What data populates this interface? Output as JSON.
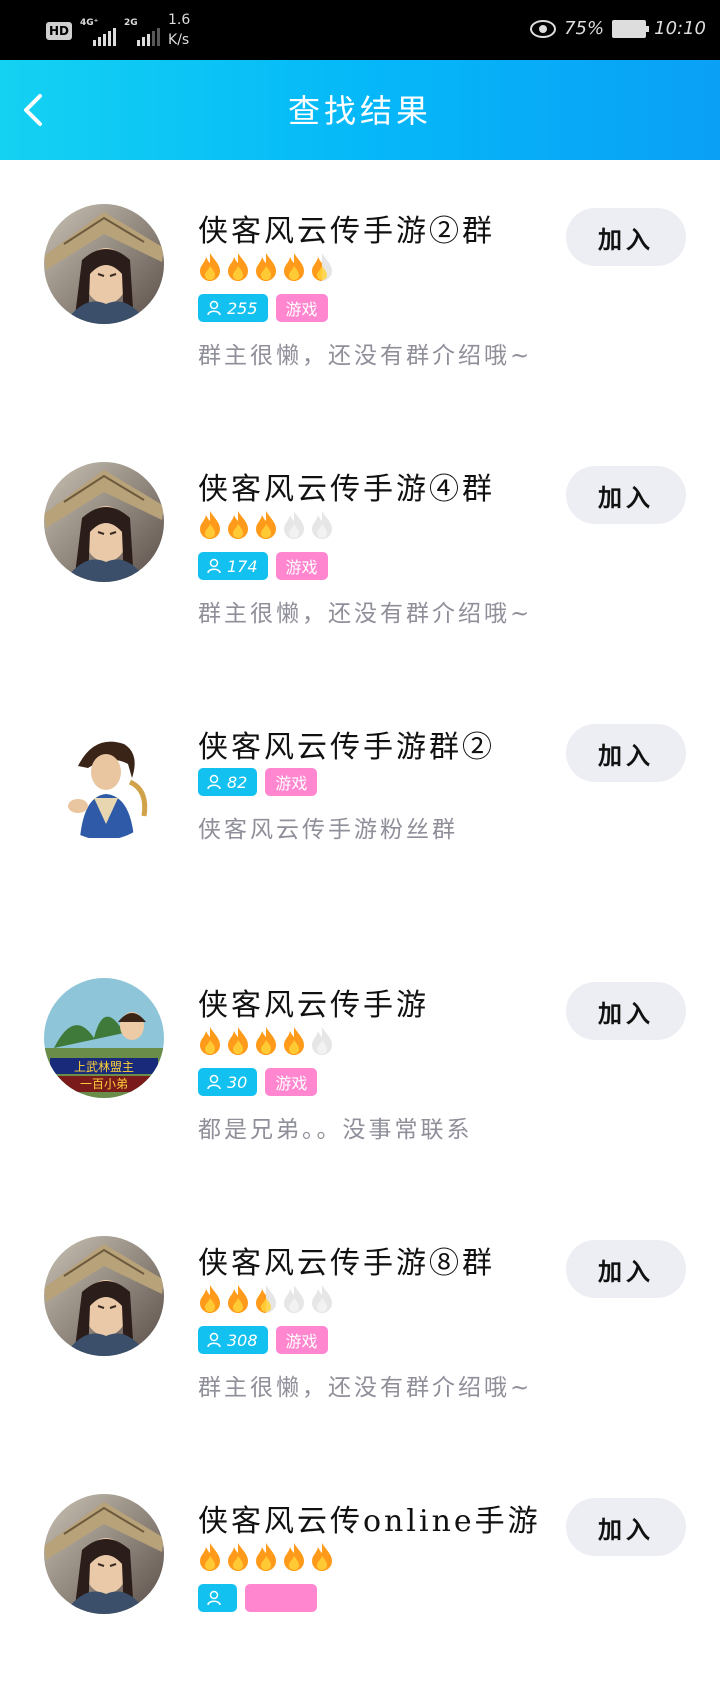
{
  "status": {
    "hd": "HD",
    "sim1": "4G⁺",
    "sim2": "2G",
    "speed_value": "1.6",
    "speed_unit": "K/s",
    "battery": "75%",
    "time": "10:10"
  },
  "header": {
    "title": "查找结果"
  },
  "groups": [
    {
      "name": "侠客风云传手游②群",
      "flames": 4.5,
      "members": "255",
      "category": "游戏",
      "desc": "群主很懒，还没有群介绍哦~",
      "join": "加入",
      "avatar": "swordsman"
    },
    {
      "name": "侠客风云传手游④群",
      "flames": 3,
      "members": "174",
      "category": "游戏",
      "desc": "群主很懒，还没有群介绍哦~",
      "join": "加入",
      "avatar": "swordsman"
    },
    {
      "name": "侠客风云传手游群②",
      "flames": 0,
      "members": "82",
      "category": "游戏",
      "desc": "侠客风云传手游粉丝群",
      "join": "加入",
      "avatar": "hero-figure"
    },
    {
      "name": "侠客风云传手游",
      "flames": 4,
      "members": "30",
      "category": "游戏",
      "desc": "都是兄弟。。没事常联系",
      "join": "加入",
      "avatar": "game-art"
    },
    {
      "name": "侠客风云传手游⑧群",
      "flames": 2.5,
      "members": "308",
      "category": "游戏",
      "desc": "群主很懒，还没有群介绍哦~",
      "join": "加入",
      "avatar": "swordsman"
    },
    {
      "name": "侠客风云传online手游",
      "flames": 5,
      "members": "",
      "category": "",
      "desc": "",
      "join": "加入",
      "avatar": "swordsman"
    }
  ],
  "colors": {
    "header_start": "#14d2f2",
    "header_end": "#0aa0f6",
    "tag_count": "#13c1f0",
    "tag_category": "#ff86cf",
    "flame": "#ff9a1a"
  }
}
